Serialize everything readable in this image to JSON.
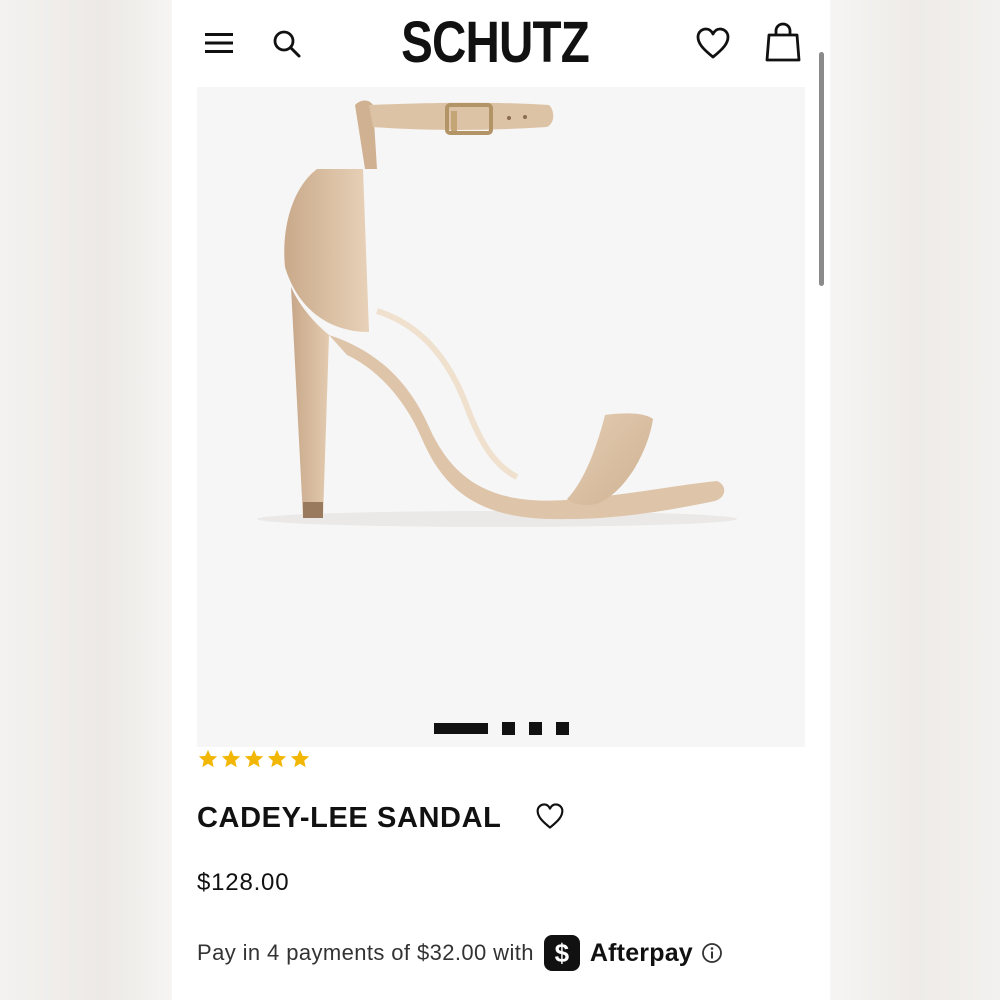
{
  "header": {
    "logo": "SCHUTZ",
    "icons": [
      "hamburger-menu-icon",
      "search-icon",
      "heart-icon",
      "shopping-bag-icon"
    ]
  },
  "gallery": {
    "image_count": 4,
    "active_index": 0
  },
  "product": {
    "rating": 5,
    "rating_max": 5,
    "name": "CADEY-LEE SANDAL",
    "price": "$128.00"
  },
  "afterpay": {
    "text": "Pay in 4 payments of $32.00 with",
    "badge_symbol": "$",
    "brand": "Afterpay"
  },
  "colors": {
    "star": "#f2b705",
    "text": "#111111",
    "image_bg": "#f6f6f6"
  }
}
